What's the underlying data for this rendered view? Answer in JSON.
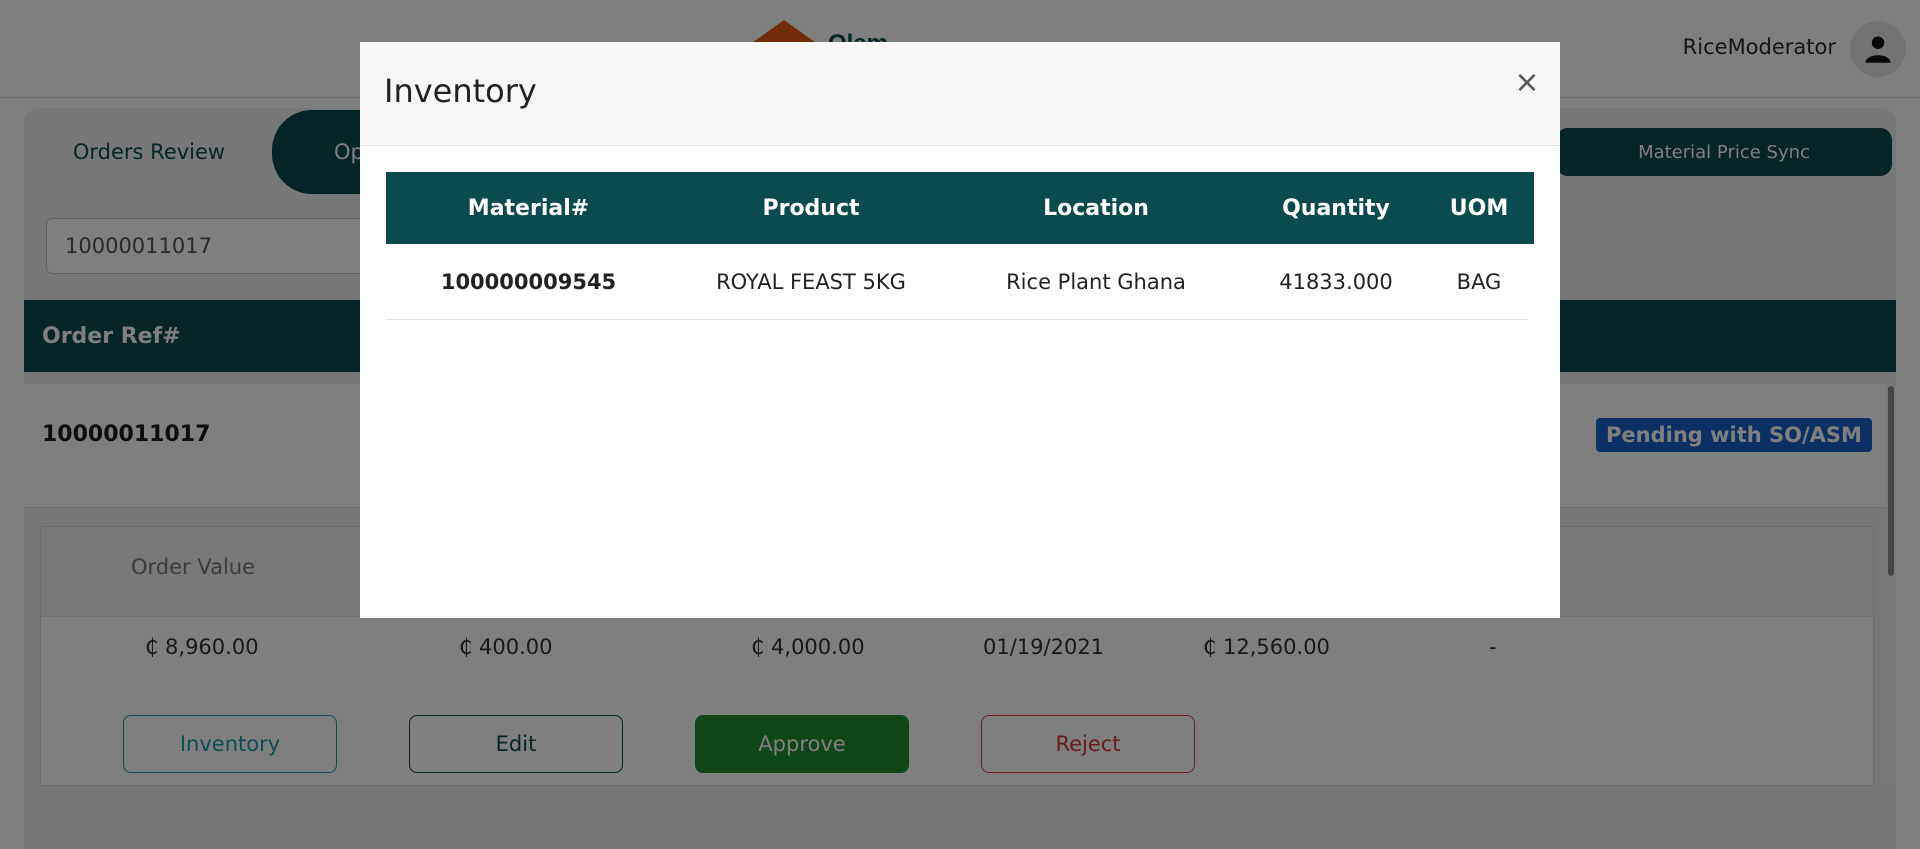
{
  "header": {
    "logo_text": "Olam",
    "user_name": "RiceModerator"
  },
  "tabs": {
    "active": "Orders Review",
    "second": "Op",
    "price_sync": "Material Price Sync"
  },
  "search": {
    "value": "10000011017"
  },
  "orders": {
    "column_header": "Order Ref#",
    "rows": [
      {
        "ref": "10000011017",
        "status": "Pending with SO/ASM"
      }
    ]
  },
  "order_detail": {
    "head_label": "Order Value",
    "values": [
      "₵ 8,960.00",
      "₵ 400.00",
      "₵ 4,000.00",
      "01/19/2021",
      "₵ 12,560.00",
      "-"
    ],
    "buttons": {
      "inventory": "Inventory",
      "edit": "Edit",
      "approve": "Approve",
      "reject": "Reject"
    }
  },
  "modal": {
    "title": "Inventory",
    "close_symbol": "×",
    "columns": [
      "Material#",
      "Product",
      "Location",
      "Quantity",
      "UOM"
    ],
    "rows": [
      {
        "material": "100000009545",
        "product": "ROYAL FEAST 5KG",
        "location": "Rice Plant Ghana",
        "quantity": "41833.000",
        "uom": "BAG"
      }
    ]
  },
  "colors": {
    "primary": "#0b4a4f",
    "badge": "#1763c9",
    "approve": "#1f8f32",
    "reject": "#d03a3a",
    "inventory_btn": "#1c9aa8",
    "logo": "#e25a12"
  },
  "icons": {
    "avatar": "user-icon",
    "close": "close-icon"
  }
}
